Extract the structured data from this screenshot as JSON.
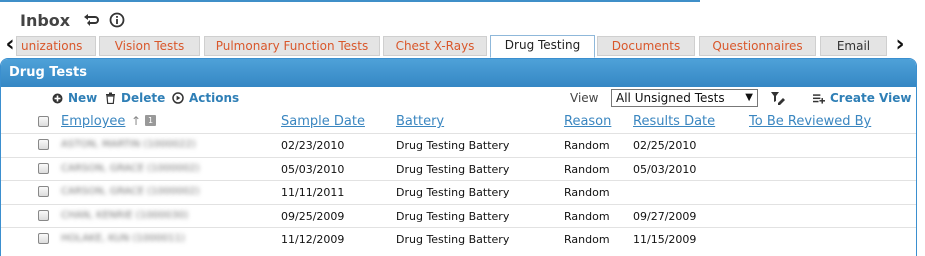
{
  "header": {
    "title": "Inbox"
  },
  "tabs": [
    {
      "label": "unizations",
      "name": "tab-immunizations"
    },
    {
      "label": "Vision Tests",
      "name": "tab-vision-tests"
    },
    {
      "label": "Pulmonary Function Tests",
      "name": "tab-pulmonary-function-tests"
    },
    {
      "label": "Chest X-Rays",
      "name": "tab-chest-x-rays"
    },
    {
      "label": "Drug Testing",
      "name": "tab-drug-testing"
    },
    {
      "label": "Documents",
      "name": "tab-documents"
    },
    {
      "label": "Questionnaires",
      "name": "tab-questionnaires"
    },
    {
      "label": "Email",
      "name": "tab-email"
    }
  ],
  "nav": {
    "left": "‹",
    "right": "›"
  },
  "panel": {
    "title": "Drug Tests"
  },
  "toolbar": {
    "new_label": "New",
    "delete_label": "Delete",
    "actions_label": "Actions",
    "view_label": "View",
    "view_value": "All Unsigned Tests",
    "create_view_label": "Create View"
  },
  "table": {
    "headers": {
      "employee": "Employee",
      "sample_date": "Sample Date",
      "battery": "Battery",
      "reason": "Reason",
      "results_date": "Results Date",
      "reviewer": "To Be Reviewed By"
    },
    "sort_badge": "1",
    "rows": [
      {
        "employee": "ASTON, MARTIN (1000022)",
        "sample_date": "02/23/2010",
        "battery": "Drug Testing Battery",
        "reason": "Random",
        "results_date": "02/25/2010",
        "reviewer": ""
      },
      {
        "employee": "CARSON, GRACE (1000002)",
        "sample_date": "05/03/2010",
        "battery": "Drug Testing Battery",
        "reason": "Random",
        "results_date": "05/03/2010",
        "reviewer": ""
      },
      {
        "employee": "CARSON, GRACE (1000002)",
        "sample_date": "11/11/2011",
        "battery": "Drug Testing Battery",
        "reason": "Random",
        "results_date": "",
        "reviewer": ""
      },
      {
        "employee": "CHAN, KENRIE (1000030)",
        "sample_date": "09/25/2009",
        "battery": "Drug Testing Battery",
        "reason": "Random",
        "results_date": "09/27/2009",
        "reviewer": ""
      },
      {
        "employee": "HOLAKE, KUN (1000011)",
        "sample_date": "11/12/2009",
        "battery": "Drug Testing Battery",
        "reason": "Random",
        "results_date": "11/15/2009",
        "reviewer": ""
      }
    ]
  }
}
